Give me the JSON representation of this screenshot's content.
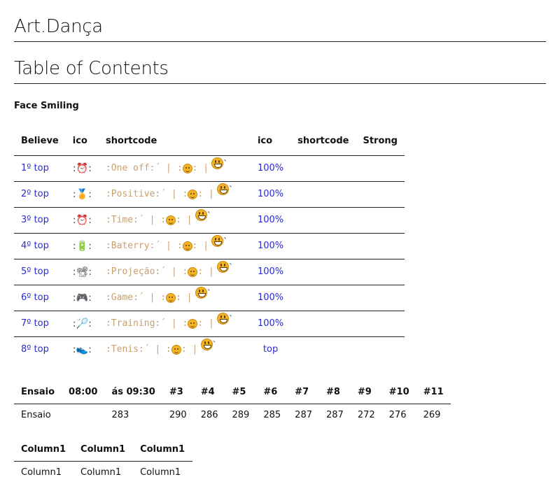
{
  "page": {
    "title": "Art.Dança",
    "toc_heading": "Table of Contents",
    "subheading": "Face Smiling"
  },
  "table1": {
    "headers": [
      "Believe",
      "ico",
      "shortcode",
      "ico",
      "shortcode",
      "Strong"
    ],
    "rows": [
      {
        "link": "1º top",
        "icon": "alarm-clock-icon",
        "glyph": "⏰",
        "code": ":One off:´ | :",
        "code_end": ": |",
        "pct": "100%"
      },
      {
        "link": "2º top",
        "icon": "medal-icon",
        "glyph": "🏅",
        "code": ":Positive:´ | :",
        "code_end": ": |",
        "pct": "100%"
      },
      {
        "link": "3º top",
        "icon": "alarm-clock-icon",
        "glyph": "⏰",
        "code": ":Time:´ | :",
        "code_end": ": |",
        "pct": "100%"
      },
      {
        "link": "4º top",
        "icon": "battery-icon",
        "glyph": "🔋",
        "code": ":Baterry:´ | :",
        "code_end": ": |",
        "pct": "100%"
      },
      {
        "link": "5º top",
        "icon": "film-projector-icon",
        "glyph": "📽",
        "code": ":Projeção:´ | :",
        "code_end": ": |",
        "pct": "100%"
      },
      {
        "link": "6º top",
        "icon": "game-controller-icon",
        "glyph": "🎮",
        "code": ":Game:´ | :",
        "code_end": ": |",
        "pct": "100%"
      },
      {
        "link": "7º top",
        "icon": "badminton-icon",
        "glyph": "🏸",
        "code": ":Training:´ | :",
        "code_end": ": |",
        "pct": "100%"
      },
      {
        "link": "8º top",
        "icon": "sneaker-icon",
        "glyph": "👟",
        "code": ":Tenis:´ | :",
        "code_end": ": |",
        "pct": "top"
      }
    ]
  },
  "table2": {
    "headers": [
      "Ensaio",
      "08:00",
      "ás 09:30",
      "#3",
      "#4",
      "#5",
      "#6",
      "#7",
      "#8",
      "#9",
      "#10",
      "#11"
    ],
    "row": [
      "Ensaio",
      "",
      "283",
      "290",
      "286",
      "289",
      "285",
      "287",
      "287",
      "272",
      "276",
      "269"
    ]
  },
  "table3": {
    "headers": [
      "Column1",
      "Column1",
      "Column1"
    ],
    "row": [
      "Column1",
      "Column1",
      "Column1"
    ]
  },
  "colors": {
    "link": "#2a2ad6",
    "code": "#c8a070",
    "rule": "#222222",
    "emoji_face": "#f2b324"
  }
}
